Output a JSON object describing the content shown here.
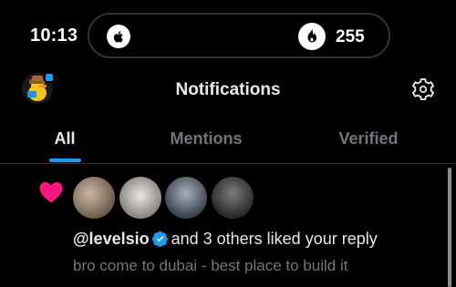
{
  "status_bar": {
    "time": "10:13",
    "activity_count": "255"
  },
  "header": {
    "title": "Notifications"
  },
  "tabs": [
    {
      "label": "All",
      "active": true
    },
    {
      "label": "Mentions",
      "active": false
    },
    {
      "label": "Verified",
      "active": false
    }
  ],
  "notification": {
    "type_icon": "heart-icon",
    "user": "@levelsio",
    "action_text": "and 3 others liked your reply",
    "reply_text": "bro come to dubai - best place to build it"
  },
  "colors": {
    "accent": "#1d9bf0",
    "like": "#f91880",
    "background": "#000000",
    "primary_text": "#e7e9ea",
    "secondary_text": "#71767b"
  }
}
